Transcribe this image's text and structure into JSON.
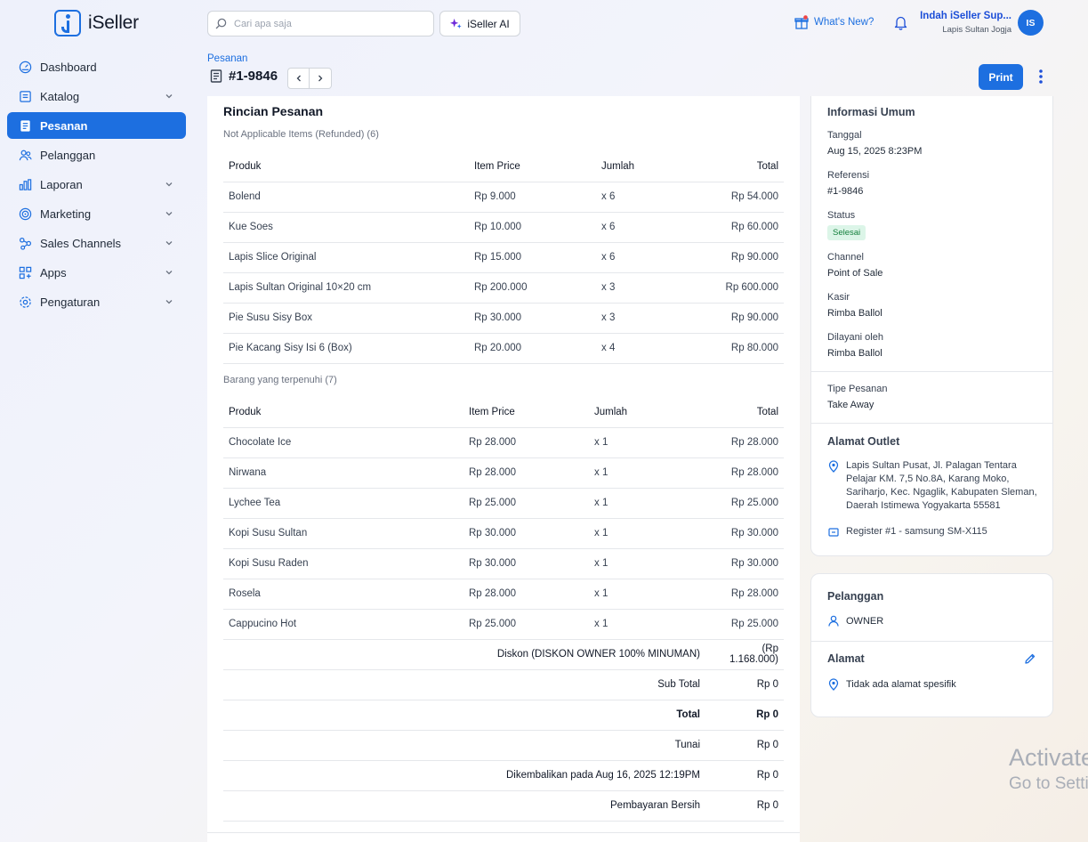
{
  "header": {
    "brand": "iSeller",
    "search_placeholder": "Cari apa saja",
    "ai_label": "iSeller AI",
    "whats_new": "What's New?",
    "user_name": "Indah iSeller Sup...",
    "user_store": "Lapis Sultan Jogja",
    "avatar_initials": "IS"
  },
  "sidebar": {
    "items": [
      {
        "label": "Dashboard",
        "icon": "dashboard-icon"
      },
      {
        "label": "Katalog",
        "icon": "catalog-icon"
      },
      {
        "label": "Pesanan",
        "icon": "orders-icon"
      },
      {
        "label": "Pelanggan",
        "icon": "customers-icon"
      },
      {
        "label": "Laporan",
        "icon": "reports-icon"
      },
      {
        "label": "Marketing",
        "icon": "target-icon"
      },
      {
        "label": "Sales Channels",
        "icon": "channels-icon"
      },
      {
        "label": "Apps",
        "icon": "apps-icon"
      },
      {
        "label": "Pengaturan",
        "icon": "settings-icon"
      }
    ]
  },
  "page": {
    "breadcrumb": "Pesanan",
    "order_number": "#1-9846",
    "print_label": "Print"
  },
  "order": {
    "title": "Rincian Pesanan",
    "refunded_label": "Not Applicable Items (Refunded) (6)",
    "fulfilled_label": "Barang yang terpenuhi (7)",
    "columns": {
      "product": "Produk",
      "price": "Item Price",
      "qty": "Jumlah",
      "total": "Total"
    },
    "refunded_items": [
      {
        "name": "Bolend",
        "price": "Rp 9.000",
        "qty": "x 6",
        "total": "Rp 54.000"
      },
      {
        "name": "Kue Soes",
        "price": "Rp 10.000",
        "qty": "x 6",
        "total": "Rp 60.000"
      },
      {
        "name": "Lapis Slice Original",
        "price": "Rp 15.000",
        "qty": "x 6",
        "total": "Rp 90.000"
      },
      {
        "name": "Lapis Sultan Original 10×20 cm",
        "price": "Rp 200.000",
        "qty": "x 3",
        "total": "Rp 600.000"
      },
      {
        "name": "Pie Susu Sisy Box",
        "price": "Rp 30.000",
        "qty": "x 3",
        "total": "Rp 90.000"
      },
      {
        "name": "Pie Kacang Sisy Isi 6 (Box)",
        "price": "Rp 20.000",
        "qty": "x 4",
        "total": "Rp 80.000"
      }
    ],
    "fulfilled_items": [
      {
        "name": "Chocolate Ice",
        "price": "Rp 28.000",
        "qty": "x 1",
        "total": "Rp 28.000"
      },
      {
        "name": "Nirwana",
        "price": "Rp 28.000",
        "qty": "x 1",
        "total": "Rp 28.000"
      },
      {
        "name": "Lychee Tea",
        "price": "Rp 25.000",
        "qty": "x 1",
        "total": "Rp 25.000"
      },
      {
        "name": "Kopi Susu Sultan",
        "price": "Rp 30.000",
        "qty": "x 1",
        "total": "Rp 30.000"
      },
      {
        "name": "Kopi Susu Raden",
        "price": "Rp 30.000",
        "qty": "x 1",
        "total": "Rp 30.000"
      },
      {
        "name": "Rosela",
        "price": "Rp 28.000",
        "qty": "x 1",
        "total": "Rp 28.000"
      },
      {
        "name": "Cappucino Hot",
        "price": "Rp 25.000",
        "qty": "x 1",
        "total": "Rp 25.000"
      }
    ],
    "summary": [
      {
        "label": "Diskon (DISKON OWNER 100% MINUMAN)",
        "value": "(Rp 1.168.000)",
        "bold": false
      },
      {
        "label": "Sub Total",
        "value": "Rp 0",
        "bold": false
      },
      {
        "label": "Total",
        "value": "Rp 0",
        "bold": true
      },
      {
        "label": "Tunai",
        "value": "Rp 0",
        "bold": false
      },
      {
        "label": "Dikembalikan pada Aug 16, 2025 12:19PM",
        "value": "Rp 0",
        "bold": false
      },
      {
        "label": "Pembayaran Bersih",
        "value": "Rp 0",
        "bold": false
      }
    ]
  },
  "info": {
    "title": "Informasi Umum",
    "date_label": "Tanggal",
    "date_value": "Aug 15, 2025 8:23PM",
    "ref_label": "Referensi",
    "ref_value": "#1-9846",
    "status_label": "Status",
    "status_value": "Selesai",
    "channel_label": "Channel",
    "channel_value": "Point of Sale",
    "cashier_label": "Kasir",
    "cashier_value": "Rimba Ballol",
    "served_label": "Dilayani oleh",
    "served_value": "Rimba Ballol",
    "order_type_label": "Tipe Pesanan",
    "order_type_value": "Take Away",
    "outlet_title": "Alamat Outlet",
    "outlet_address": "Lapis Sultan Pusat, Jl. Palagan Tentara Pelajar KM. 7,5 No.8A, Karang Moko, Sariharjo, Kec. Ngaglik, Kabupaten Sleman, Daerah Istimewa Yogyakarta 55581",
    "register": "Register #1 - samsung SM-X115"
  },
  "customer": {
    "title": "Pelanggan",
    "name": "OWNER",
    "address_title": "Alamat",
    "address_value": "Tidak ada alamat spesifik"
  },
  "watermark": {
    "line1": "Activate Windows",
    "line2": "Go to Settings to activate Windows."
  },
  "colors": {
    "accent": "#1d6fe0",
    "status_bg": "#dcf5e8",
    "status_text": "#15803d"
  }
}
